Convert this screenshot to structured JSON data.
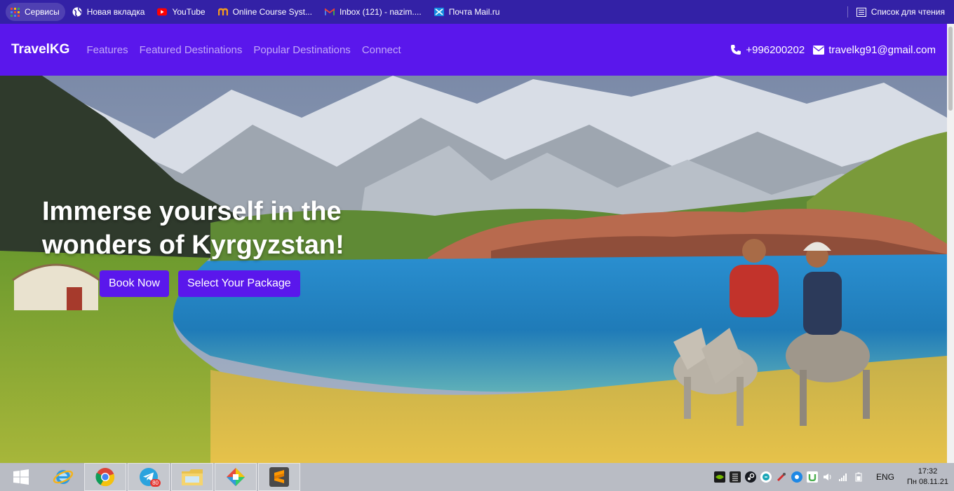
{
  "bookmarks": [
    {
      "label": "Сервисы",
      "icon": "apps-grid-icon",
      "active": true
    },
    {
      "label": "Новая вкладка",
      "icon": "globe-icon"
    },
    {
      "label": "YouTube",
      "icon": "youtube-icon"
    },
    {
      "label": "Online Course Syst...",
      "icon": "course-logo-icon"
    },
    {
      "label": "Inbox (121) - nazim....",
      "icon": "gmail-icon"
    },
    {
      "label": "Почта Mail.ru",
      "icon": "mail-ru-icon"
    }
  ],
  "reading_list": "Список для чтения",
  "navbar": {
    "brand": "TravelKG",
    "links": [
      "Features",
      "Featured Destinations",
      "Popular Destinations",
      "Connect"
    ],
    "phone": "+996200202",
    "email": "travelkg91@gmail.com"
  },
  "hero": {
    "title": "Immerse yourself in the wonders of Kyrgyzstan!",
    "book_button": "Book Now",
    "package_button": "Select Your Package"
  },
  "taskbar": {
    "apps": [
      "windows-start-icon",
      "internet-explorer-icon",
      "chrome-icon",
      "telegram-icon",
      "file-explorer-icon",
      "multicolor-app-icon",
      "sublime-text-icon"
    ],
    "telegram_badge": "80",
    "language": "ENG",
    "time": "17:32",
    "date": "Пн 08.11.21"
  },
  "colors": {
    "bookmarks_bg": "#3321a6",
    "navbar_bg": "#5a17ec",
    "accent": "#5a17ec",
    "taskbar_bg": "#b9bcc4"
  }
}
